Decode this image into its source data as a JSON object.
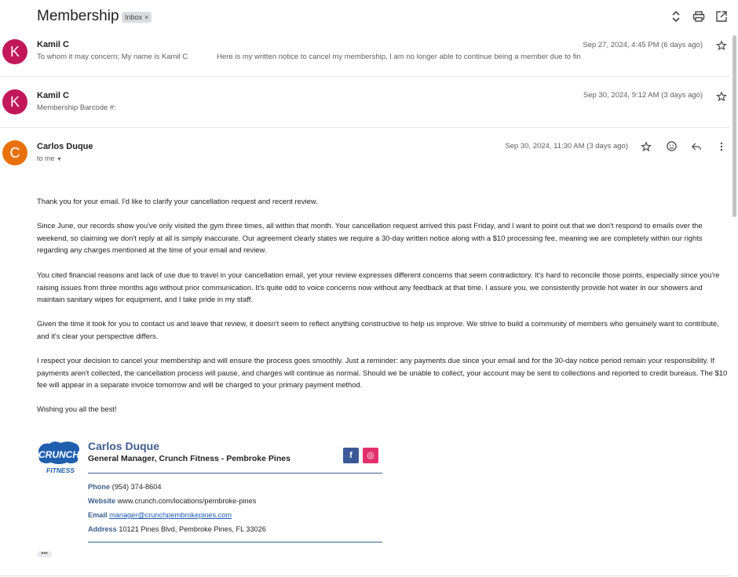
{
  "thread": {
    "subject": "Membership",
    "label": "Inbox",
    "label_close": "×"
  },
  "toolbar": {
    "icons": [
      "expand-collapse-icon",
      "print-icon",
      "open-new-window-icon"
    ]
  },
  "messages": [
    {
      "avatar_initial": "K",
      "avatar_color": "#c2185b",
      "sender": "Kamil C",
      "snippet": "To whom it may concern; My name is Kamil C              Here is my written notice to cancel my membership, I am no longer able to continue being a member due to fin",
      "date": "Sep 27, 2024, 4:45 PM (6 days ago)"
    },
    {
      "avatar_initial": "K",
      "avatar_color": "#c2185b",
      "sender": "Kamil C",
      "snippet": "Membership Barcode #:",
      "date": "Sep 30, 2024, 9:12 AM (3 days ago)"
    },
    {
      "avatar_initial": "C",
      "avatar_color": "#e8710a",
      "sender": "Carlos Duque",
      "recipient": "to me",
      "date": "Sep 30, 2024, 11:30 AM (3 days ago)",
      "body": [
        "Thank you for your email. I'd like to clarify your cancellation request and recent review.",
        "Since June, our records show you've only visited the gym three times, all within that month. Your cancellation request arrived this past Friday, and I want to point out that we don't respond to emails over the weekend, so claiming we don't reply at all is simply inaccurate. Our agreement clearly states we require a 30-day written notice along with a $10 processing fee, meaning we are completely within our rights regarding any charges mentioned at the time of your email and review.",
        "You cited financial reasons and lack of use due to travel in your cancellation email, yet your review expresses different concerns that seem contradictory. It's hard to reconcile those points, especially since you're raising issues from three months ago without prior communication. It's quite odd to voice concerns now without any feedback at that time. I assure you, we consistently provide hot water in our showers and maintain sanitary wipes for equipment, and I take pride in my staff.",
        "Given the time it took for you to contact us and leave that review, it doesn't seem to reflect anything constructive to help us improve. We strive to build a community of members who genuinely want to contribute, and it's clear your perspective differs.",
        "I respect your decision to cancel your membership and will ensure the process goes smoothly. Just a reminder: any payments due since your email and for the 30-day notice period remain your responsibility. If payments aren't collected, the cancellation process will pause, and charges will continue as normal. Should we be unable to collect, your account may be sent to collections and reported to credit bureaus. The $10 fee will appear in a separate invoice tomorrow and will be charged to your primary payment method.",
        "Wishing you all the best!"
      ]
    }
  ],
  "signature": {
    "logo_text_top": "CRUNCH",
    "logo_text_bottom": "FITNESS",
    "name": "Carlos Duque",
    "title": "General Manager, Crunch Fitness - Pembroke Pines",
    "phone_label": "Phone",
    "phone": "(954) 374-8604",
    "website_label": "Website",
    "website": "www.crunch.com/locations/pembroke-pines",
    "email_label": "Email",
    "email": "manager@crunchpembrokepines.com",
    "address_label": "Address",
    "address": "10121 Pines Blvd, Pembroke Pines, FL 33026",
    "facebook_glyph": "f",
    "instagram_glyph": "◎"
  },
  "colors": {
    "facebook": "#3b5998",
    "instagram": "#e1306c",
    "signature_accent": "#3e5e8c",
    "crunch_blue": "#1f5fae"
  },
  "show_trimmed_content": "•••"
}
